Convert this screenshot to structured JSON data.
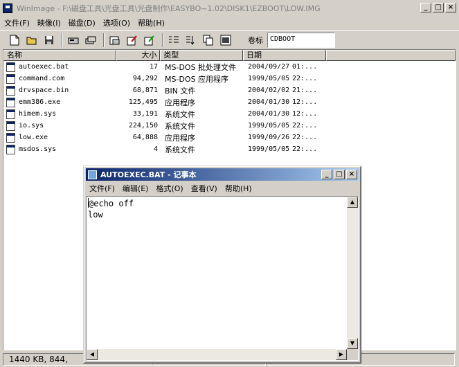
{
  "main_window": {
    "title": "WinImage - F:\\磁盘工具\\光盘工具\\光盘制作\\EASYBO~1.02\\DISK1\\EZBOOT\\LOW.IMG",
    "buttons": {
      "minimize": "_",
      "maximize": "□",
      "close": "×"
    }
  },
  "menu": [
    "文件(F)",
    "映像(I)",
    "磁盘(D)",
    "选项(O)",
    "帮助(H)"
  ],
  "toolbar": {
    "icons": [
      "new-icon",
      "open-icon",
      "save-icon",
      "disk-icon",
      "disk-copy-icon",
      "format-icon",
      "inject-icon",
      "extract-icon",
      "list-icon",
      "sort-icon",
      "copy-icon",
      "properties-icon"
    ],
    "volume_label": "卷标",
    "volume_value": "CDBOOT"
  },
  "file_list": {
    "columns": [
      "名称",
      "大小",
      "类型",
      "日期"
    ],
    "rows": [
      {
        "name": "autoexec.bat",
        "size": "17",
        "type": "MS-DOS 批处理文件",
        "date": "2004/09/27",
        "time": "01:..."
      },
      {
        "name": "command.com",
        "size": "94,292",
        "type": "MS-DOS 应用程序",
        "date": "1999/05/05",
        "time": "22:..."
      },
      {
        "name": "drvspace.bin",
        "size": "68,871",
        "type": "BIN 文件",
        "date": "2004/02/02",
        "time": "21:..."
      },
      {
        "name": "emm386.exe",
        "size": "125,495",
        "type": "应用程序",
        "date": "2004/01/30",
        "time": "12:..."
      },
      {
        "name": "himem.sys",
        "size": "33,191",
        "type": "系统文件",
        "date": "2004/01/30",
        "time": "12:..."
      },
      {
        "name": "io.sys",
        "size": "224,150",
        "type": "系统文件",
        "date": "1999/05/05",
        "time": "22:..."
      },
      {
        "name": "low.exe",
        "size": "64,888",
        "type": "应用程序",
        "date": "1999/09/26",
        "time": "22:..."
      },
      {
        "name": "msdos.sys",
        "size": "4",
        "type": "系统文件",
        "date": "1999/05/05",
        "time": "22:..."
      }
    ]
  },
  "status": {
    "text": "1440 KB, 844,"
  },
  "notepad": {
    "title": "AUTOEXEC.BAT - 记事本",
    "menu": [
      "文件(F)",
      "编辑(E)",
      "格式(O)",
      "查看(V)",
      "帮助(H)"
    ],
    "lines": [
      "@echo off",
      "low"
    ]
  }
}
